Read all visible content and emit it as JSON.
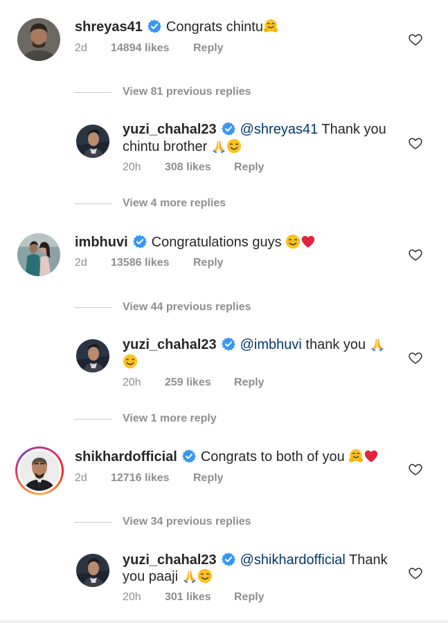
{
  "accent": {
    "verified": "#3897f0",
    "mention": "#00376b",
    "meta": "#8e8e8e",
    "heart_red": "#ed4956"
  },
  "icons": {
    "verified": "verified-badge-icon",
    "heart": "heart-outline-icon",
    "hug": "hugging-face-emoji",
    "pray": "folded-hands-emoji",
    "smile": "smiling-face-emoji",
    "red_heart": "red-heart-emoji"
  },
  "threads": [
    {
      "comment": {
        "user": "shreyas41",
        "text": "Congrats chintu",
        "time": "2d",
        "likes": "14894 likes",
        "reply": "Reply"
      },
      "view_replies": "View 81 previous replies",
      "reply": {
        "user": "yuzi_chahal23",
        "mention": "@shreyas41",
        "text_line1": " Thank you",
        "text_line2": "chintu brother ",
        "time": "20h",
        "likes": "308 likes",
        "reply": "Reply"
      },
      "more_replies": "View 4 more replies"
    },
    {
      "comment": {
        "user": "imbhuvi",
        "text": "Congratulations guys ",
        "time": "2d",
        "likes": "13586 likes",
        "reply": "Reply"
      },
      "view_replies": "View 44 previous replies",
      "reply": {
        "user": "yuzi_chahal23",
        "mention": "@imbhuvi",
        "text_line1": " thank you ",
        "text_line2": "",
        "time": "20h",
        "likes": "259 likes",
        "reply": "Reply"
      },
      "more_replies": "View 1 more reply"
    },
    {
      "comment": {
        "user": "shikhardofficial",
        "text": "Congrats to both of you ",
        "time": "2d",
        "likes": "12716 likes",
        "reply": "Reply"
      },
      "view_replies": "View 34 previous replies",
      "reply": {
        "user": "yuzi_chahal23",
        "mention": "@shikhardofficial",
        "text_line1": " Thank",
        "text_line2": "you paaji ",
        "time": "20h",
        "likes": "301 likes",
        "reply": "Reply"
      }
    }
  ]
}
